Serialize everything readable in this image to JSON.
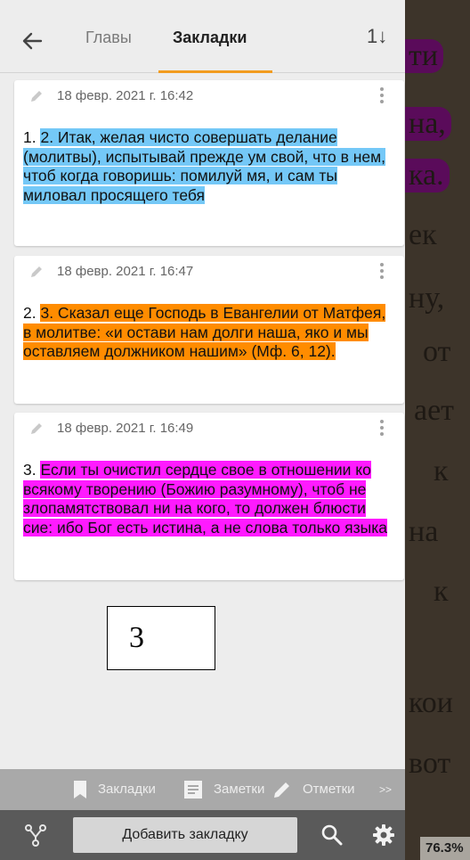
{
  "book": {
    "lines": [
      "ти",
      "на,",
      "ка.",
      "ек",
      "ну,",
      "от",
      "ает",
      "к",
      "на",
      "к",
      "",
      "кои",
      "вот"
    ],
    "progress": "76.3%"
  },
  "header": {
    "chapters_tab": "Главы",
    "bookmarks_tab": "Закладки",
    "sort_symbol": "1↓"
  },
  "bookmarks": [
    {
      "date": "18 февр. 2021 г. 16:42",
      "number": "1. ",
      "text": "2. Итак, желая чисто совершать делание (молитвы), испытывай прежде ум свой, что в нем, чтоб когда говоришь: помилуй мя, и сам ты миловал просящего тебя",
      "color": "#74c8f7"
    },
    {
      "date": "18 февр. 2021 г. 16:47",
      "number": "2. ",
      "text": "3. Сказал еще Господь в Евангелии от Матфея, в молитве: «и остави нам долги наша, яко и мы оставляем должником нашим» (Мф. 6, 12).",
      "color": "#ff8c00"
    },
    {
      "date": "18 февр. 2021 г. 16:49",
      "number": "3. ",
      "text": "Если ты очистил сердце свое в отношении ко всякому творению (Божию разумному), чтоб не злопамятствовал ни на кого, то должен блюсти сие: ибо Бог есть истина, а не слова только языка",
      "color": "#ff1aff"
    }
  ],
  "annotation": "3",
  "quick_bar": {
    "bookmarks": "Закладки",
    "notes": "Заметки",
    "marks": "Отметки",
    "more": ">>"
  },
  "bottom_bar": {
    "add_bookmark": "Добавить закладку"
  },
  "colors": {
    "accent": "#f29c1f"
  }
}
